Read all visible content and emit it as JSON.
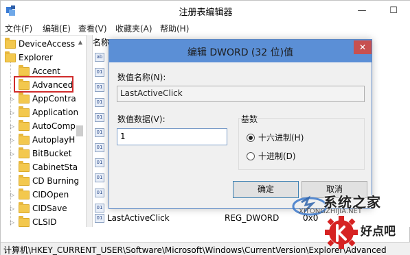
{
  "window": {
    "title": "注册表编辑器",
    "min_glyph": "—",
    "max_glyph": "☐"
  },
  "menu": [
    {
      "label": "文件(F)"
    },
    {
      "label": "编辑(E)"
    },
    {
      "label": "查看(V)"
    },
    {
      "label": "收藏夹(A)"
    },
    {
      "label": "帮助(H)"
    }
  ],
  "tree": {
    "items": [
      {
        "label": "DeviceAccess",
        "selected": false
      },
      {
        "label": "Explorer",
        "selected": false
      },
      {
        "label": "Accent",
        "selected": false
      },
      {
        "label": "Advanced",
        "selected": true
      },
      {
        "label": "AppContra",
        "selected": false
      },
      {
        "label": "Application",
        "selected": false
      },
      {
        "label": "AutoComp",
        "selected": false
      },
      {
        "label": "AutoplayH",
        "selected": false
      },
      {
        "label": "BitBucket",
        "selected": false
      },
      {
        "label": "CabinetSta",
        "selected": false
      },
      {
        "label": "CD Burning",
        "selected": false
      },
      {
        "label": "CIDOpen",
        "selected": false
      },
      {
        "label": "CIDSave",
        "selected": false
      },
      {
        "label": "CLSID",
        "selected": false
      }
    ],
    "highlight_color": "#d02b2b"
  },
  "list": {
    "header_name": "名称",
    "last_row": {
      "name": "LastActiveClick",
      "type": "REG_DWORD",
      "data": "0x0"
    }
  },
  "dialog": {
    "title": "编辑 DWORD (32 位)值",
    "close_glyph": "✕",
    "value_name_label": "数值名称(N):",
    "value_name": "LastActiveClick",
    "value_data_label": "数值数据(V):",
    "value_data": "1",
    "base_label": "基数",
    "radio_hex": "十六进制(H)",
    "radio_dec": "十进制(D)",
    "base_selected": "hex",
    "ok_label": "确定",
    "cancel_label": "取消",
    "title_color": "#5b8fd6",
    "close_color": "#c75050"
  },
  "statusbar": {
    "path": "计算机\\HKEY_CURRENT_USER\\Software\\Microsoft\\Windows\\CurrentVersion\\Explorer\\Advanced"
  },
  "watermarks": {
    "site1": "系统之家",
    "site1_sub": "XITONGZHIJIA.NET",
    "site2": "好点吧"
  }
}
